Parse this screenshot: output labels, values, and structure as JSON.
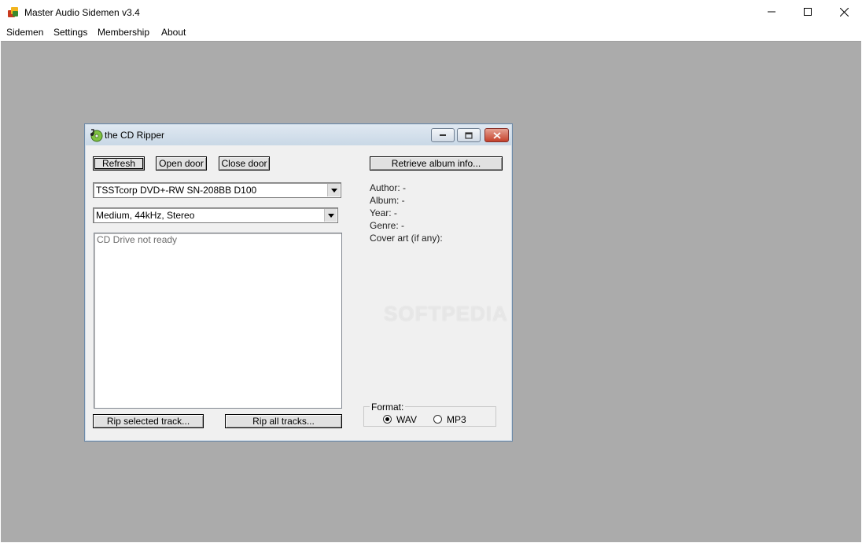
{
  "app": {
    "title": "Master Audio Sidemen v3.4"
  },
  "menu": [
    "Sidemen",
    "Settings",
    "Membership",
    "About"
  ],
  "child_window": {
    "title": "the CD Ripper",
    "buttons": {
      "refresh": "Refresh",
      "open_door": "Open door",
      "close_door": "Close door",
      "retrieve": "Retrieve album info...",
      "rip_selected": "Rip selected track...",
      "rip_all": "Rip all tracks..."
    },
    "drive_combo": "TSSTcorp DVD+-RW SN-208BB D100",
    "quality_combo": "Medium, 44kHz, Stereo",
    "track_list_status": "CD Drive not ready",
    "album_info": {
      "author": "Author: -",
      "album": "Album: -",
      "year": "Year: -",
      "genre": "Genre: -",
      "cover": "Cover art (if any):"
    },
    "format": {
      "label": "Format:",
      "options": [
        "WAV",
        "MP3"
      ],
      "selected": "WAV"
    }
  },
  "watermark": "SOFTPEDIA",
  "colors": {
    "mdi_background": "#ababab",
    "dialog_background": "#f0f0f0",
    "close_button": "#c4402a"
  }
}
